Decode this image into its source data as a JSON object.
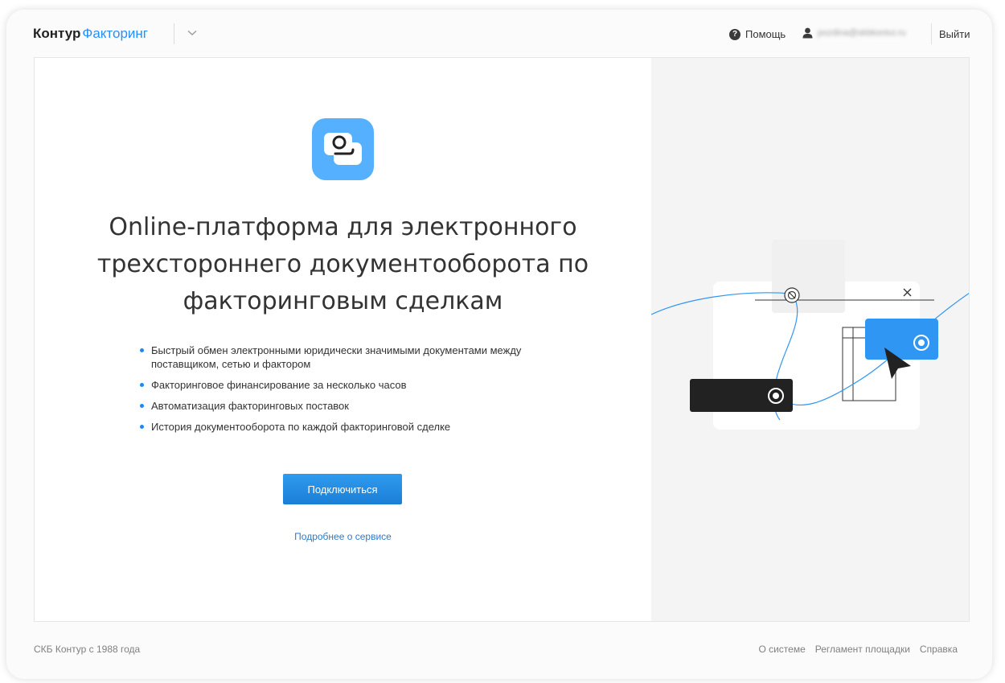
{
  "header": {
    "brand": "Контур",
    "product": "Факторинг",
    "help_label": "Помощь",
    "user_email": "pozdina@skbkontur.ru",
    "logout_label": "Выйти"
  },
  "main": {
    "headline": "Online-платформа для электронного трехстороннего документооборота по факторинговым сделкам",
    "features": [
      "Быстрый обмен электронными юридически значимыми документами между поставщиком, сетью и фактором",
      "Факторинговое финансирование за несколько часов",
      "Автоматизация факторинговых поставок",
      "История документооборота по каждой факторинговой сделке"
    ],
    "connect_label": "Подключиться",
    "more_link": "Подробнее о сервисе"
  },
  "footer": {
    "copyright": "СКБ Контур с 1988 года",
    "links": [
      "О системе",
      "Регламент площадки",
      "Справка"
    ]
  },
  "icons": [
    "chevron-down-icon",
    "help-icon",
    "user-icon",
    "app-icon",
    "close-icon",
    "cursor-icon"
  ],
  "colors": {
    "accent": "#2291ff",
    "button": "#1f87ef",
    "link": "#2d7cc8",
    "illustration_blue": "#2f96f3",
    "dark_panel": "#222222"
  }
}
